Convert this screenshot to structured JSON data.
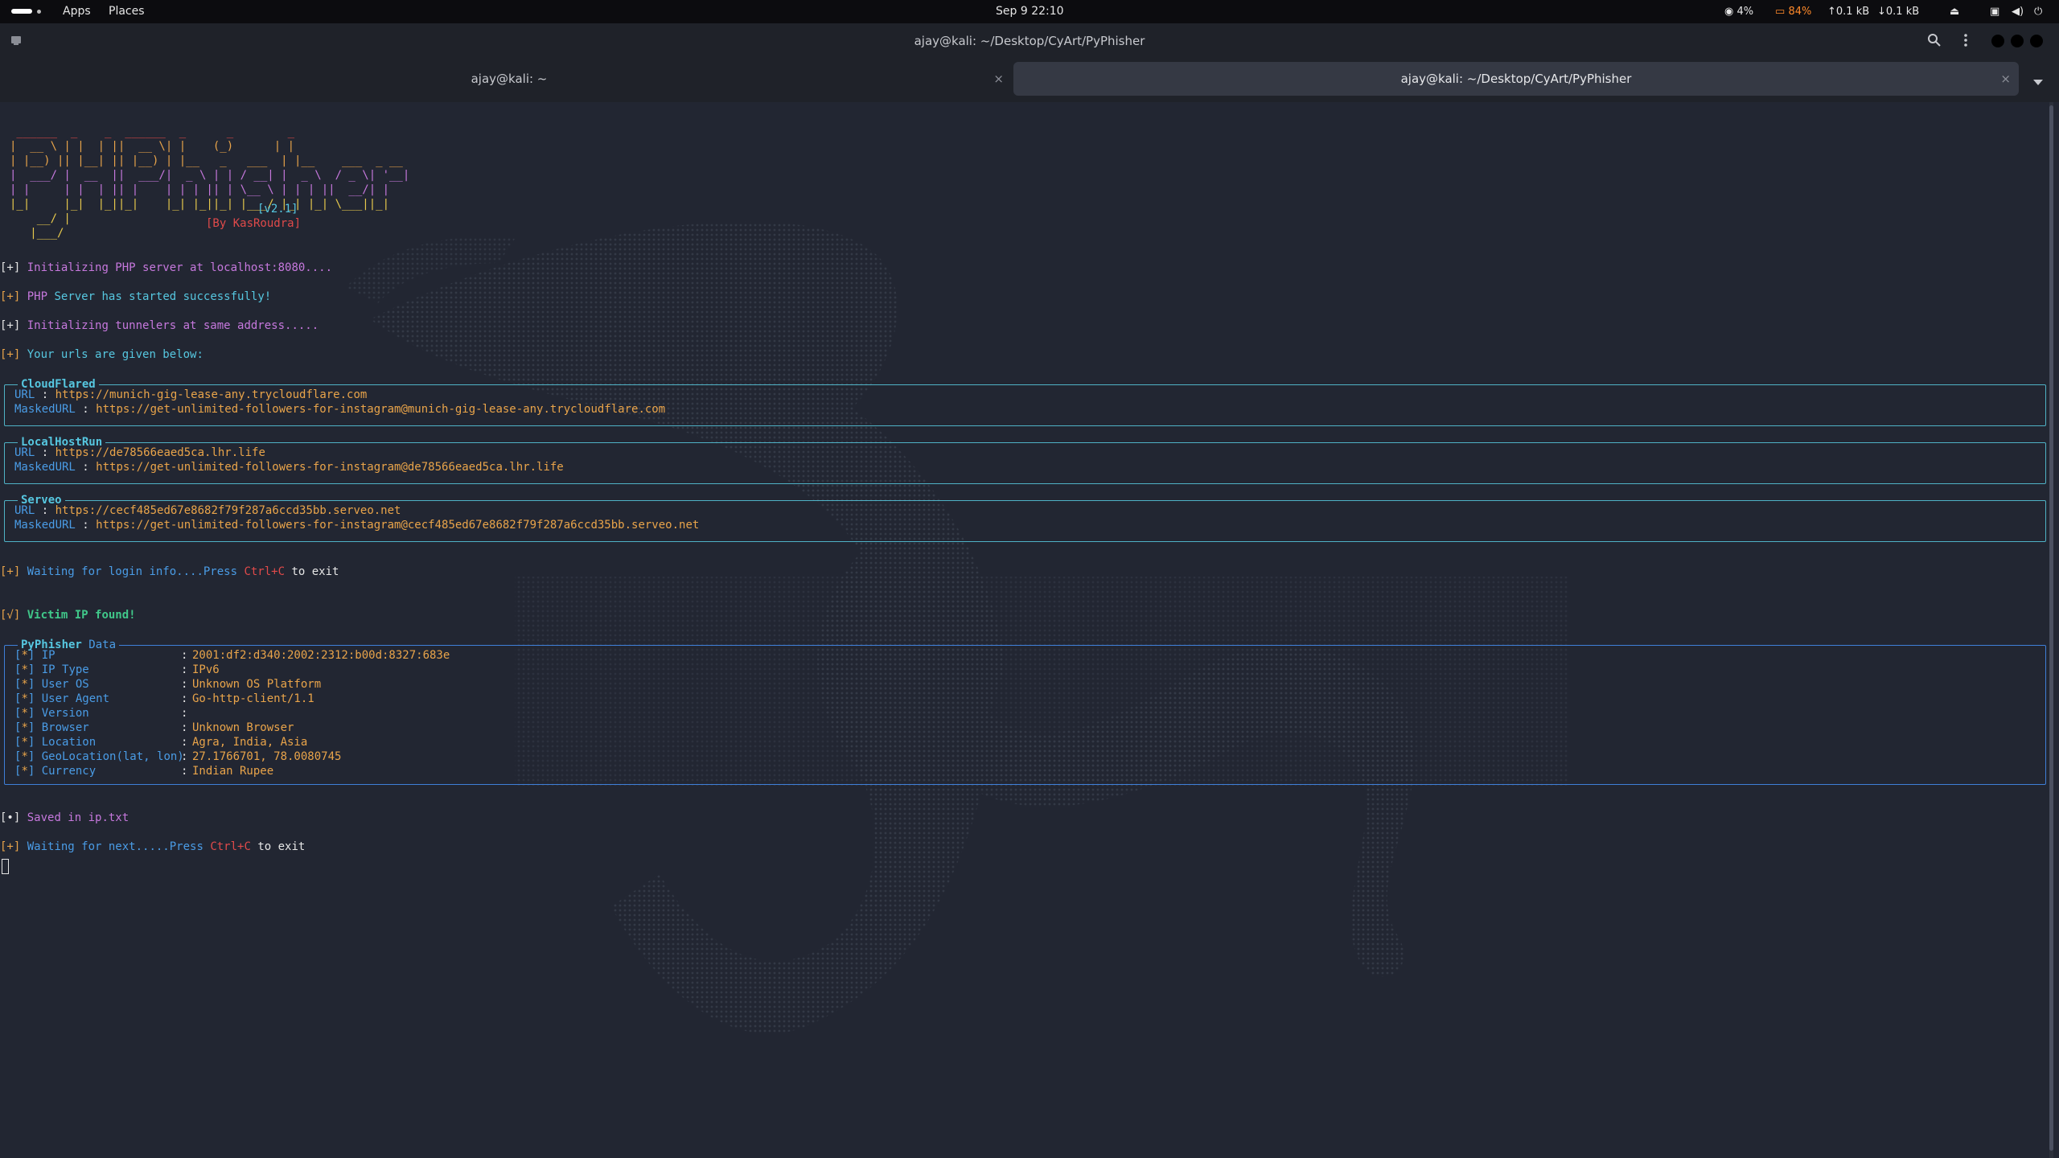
{
  "topbar": {
    "apps_label": "Apps",
    "places_label": "Places",
    "clock": "Sep 9  22:10",
    "cpu": "4%",
    "battery": "84%",
    "upload": "0.1 kB",
    "download": "0.1 kB"
  },
  "window": {
    "title": "ajay@kali: ~/Desktop/CyArt/PyPhisher",
    "tabs": [
      {
        "label": "ajay@kali: ~",
        "active": false
      },
      {
        "label": "ajay@kali: ~/Desktop/CyArt/PyPhisher",
        "active": true
      }
    ],
    "close_glyph": "×"
  },
  "banner": {
    "art_lines": [
      " ______  _    _  ______  _      _        _               ",
      "|  __ \\ | |  | ||  __ \\| |    (_)      | |              ",
      "| |__) || |__| || |__) | |__   _   ___  | |__    ___  _ __ ",
      "|  ___/ |  __  ||  ___/|  _ \\ | | / __| |  _ \\  / _ \\| '__|",
      "| |     | |  | || |    | | | || | \\__ \\ | | | ||  __/| |   ",
      "|_|     |_|  |_||_|    |_| |_||_| |___/ |_| |_| \\___||_|   "
    ],
    "art_tail": [
      "    __/ |",
      "   |___/ "
    ],
    "version": "[v2.1]",
    "author": "[By KasRoudra]"
  },
  "log": {
    "init_php": {
      "prefix": "[+]",
      "text": "Initializing PHP server at localhost:8080...."
    },
    "php_started": {
      "prefix": "[+]",
      "text_a": "PHP",
      "text_b": " Server has started successfully!"
    },
    "init_tunnel": {
      "prefix": "[+]",
      "text": "Initializing tunnelers at same address....."
    },
    "urls_given": {
      "prefix": "[+]",
      "text": "Your urls are given below:"
    },
    "waiting_login": {
      "prefix": "[+]",
      "text_a": "Waiting for login info....Press ",
      "key": "Ctrl+C",
      "text_b": " to exit"
    },
    "victim_found": {
      "prefix": "[√]",
      "text": "Victim IP found!"
    },
    "saved": {
      "prefix": "[•]",
      "text": "Saved in ip.txt"
    },
    "waiting_next": {
      "prefix": "[+]",
      "text_a": "Waiting for next.....Press ",
      "key": "Ctrl+C",
      "text_b": " to exit"
    }
  },
  "tunnels": [
    {
      "name": "CloudFlared",
      "url_label": "URL",
      "url": "https://munich-gig-lease-any.trycloudflare.com",
      "masked_label": "MaskedURL",
      "masked": "https://get-unlimited-followers-for-instagram@munich-gig-lease-any.trycloudflare.com"
    },
    {
      "name": "LocalHostRun",
      "url_label": "URL",
      "url": "https://de78566eaed5ca.lhr.life",
      "masked_label": "MaskedURL",
      "masked": "https://get-unlimited-followers-for-instagram@de78566eaed5ca.lhr.life"
    },
    {
      "name": "Serveo",
      "url_label": "URL",
      "url": "https://cecf485ed67e8682f79f287a6ccd35bb.serveo.net",
      "masked_label": "MaskedURL",
      "masked": "https://get-unlimited-followers-for-instagram@cecf485ed67e8682f79f287a6ccd35bb.serveo.net"
    }
  ],
  "pyphisher": {
    "title_a": "PyPhisher",
    "title_b": " Data",
    "rows": [
      {
        "key": "IP",
        "value": "2001:df2:d340:2002:2312:b00d:8327:683e"
      },
      {
        "key": "IP Type",
        "value": "IPv6"
      },
      {
        "key": "User OS",
        "value": "Unknown OS Platform"
      },
      {
        "key": "User Agent",
        "value": "Go-http-client/1.1"
      },
      {
        "key": "Version",
        "value": ""
      },
      {
        "key": "Browser",
        "value": "Unknown Browser"
      },
      {
        "key": "Location",
        "value": "Agra, India, Asia"
      },
      {
        "key": "GeoLocation(lat, lon)",
        "value": "27.1766701, 78.0080745"
      },
      {
        "key": "Currency",
        "value": "Indian Rupee"
      }
    ]
  },
  "colors": {
    "background": "#222632",
    "purple": "#c678dd",
    "cyan": "#56c7e0",
    "gold": "#e9a44a",
    "red": "#e04a4a",
    "green": "#40c88a"
  }
}
